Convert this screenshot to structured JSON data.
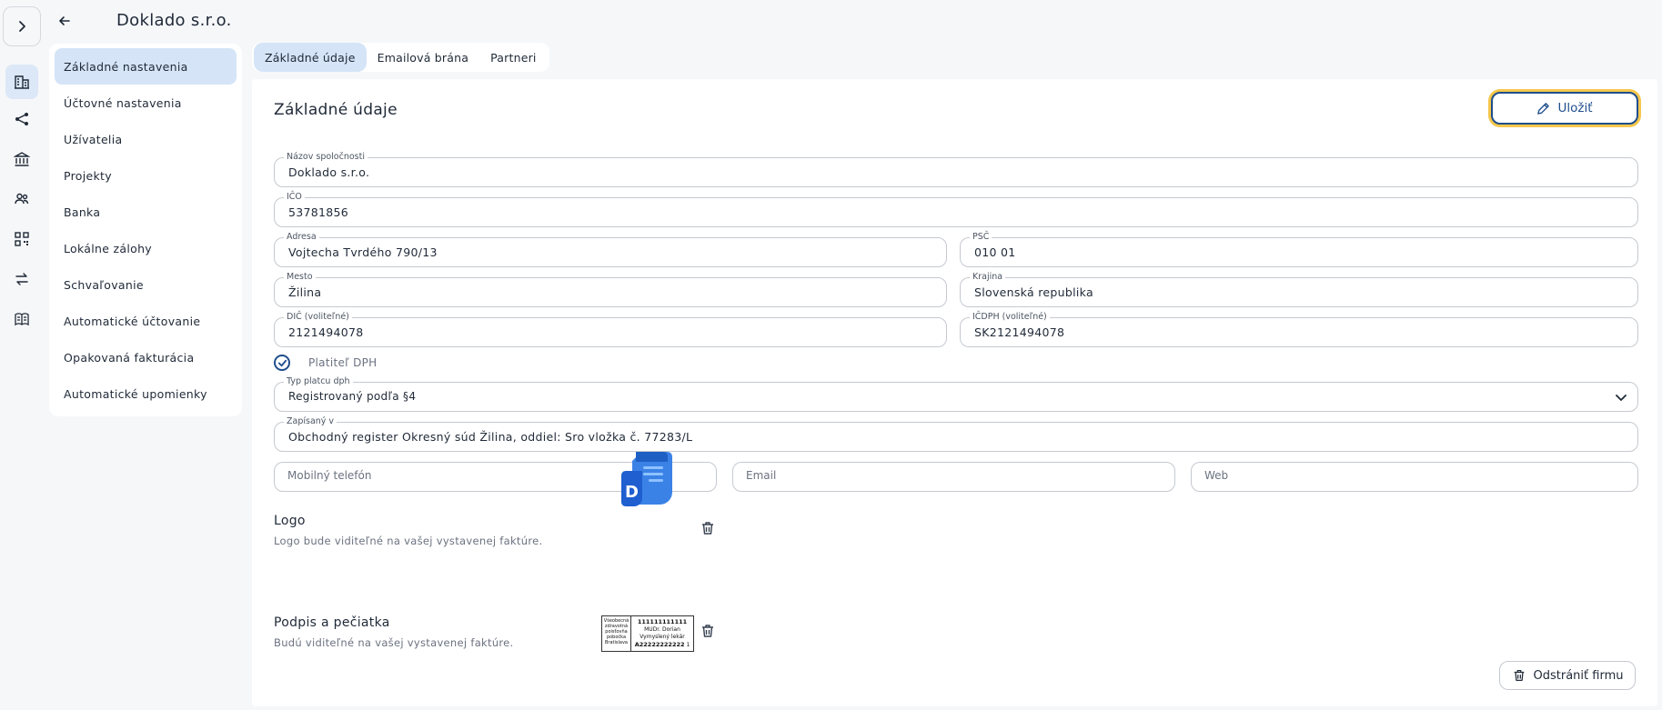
{
  "header": {
    "title": "Doklado s.r.o."
  },
  "menu": {
    "items": [
      {
        "label": "Základné nastavenia",
        "active": true
      },
      {
        "label": "Účtovné nastavenia"
      },
      {
        "label": "Užívatelia"
      },
      {
        "label": "Projekty"
      },
      {
        "label": "Banka"
      },
      {
        "label": "Lokálne zálohy"
      },
      {
        "label": "Schvaľovanie"
      },
      {
        "label": "Automatické účtovanie"
      },
      {
        "label": "Opakovaná fakturácia"
      },
      {
        "label": "Automatické upomienky"
      }
    ]
  },
  "tabs": [
    {
      "label": "Základné údaje",
      "active": true
    },
    {
      "label": "Emailová brána"
    },
    {
      "label": "Partneri"
    }
  ],
  "section": {
    "title": "Základné údaje",
    "save_label": "Uložiť"
  },
  "fields": {
    "company_name": {
      "label": "Názov spoločnosti",
      "value": "Doklado s.r.o."
    },
    "ico": {
      "label": "IČO",
      "value": "53781856"
    },
    "address": {
      "label": "Adresa",
      "value": "Vojtecha Tvrdého 790/13"
    },
    "psc": {
      "label": "PSČ",
      "value": "010 01"
    },
    "city": {
      "label": "Mesto",
      "value": "Žilina"
    },
    "country": {
      "label": "Krajina",
      "value": "Slovenská republika"
    },
    "dic": {
      "label": "DIČ (voliteľné)",
      "value": "2121494078"
    },
    "icdph": {
      "label": "IČDPH (voliteľné)",
      "value": "SK2121494078"
    },
    "vat_payer": {
      "label": "Platiteľ DPH",
      "checked": true
    },
    "vat_type": {
      "label": "Typ platcu dph",
      "value": "Registrovaný podľa §4"
    },
    "registered": {
      "label": "Zapísaný v",
      "value": "Obchodný register Okresný súd Žilina, oddiel: Sro vložka č. 77283/L"
    },
    "phone": {
      "placeholder": "Mobilný telefón"
    },
    "email": {
      "placeholder": "Email"
    },
    "web": {
      "placeholder": "Web"
    }
  },
  "logo": {
    "title": "Logo",
    "description": "Logo bude viditeľné na vašej vystavenej faktúre.",
    "letter": "D"
  },
  "signature": {
    "title": "Podpis a pečiatka",
    "description": "Budú viditeľné na vašej vystavenej faktúre.",
    "stamp_left": "Všeobecná zdravotná poisťovňa pobočka Bratislava",
    "stamp_line1": "111111111111",
    "stamp_line2": "MUDr. Dorian Vymyslený lekár",
    "stamp_line3": "A22222222222",
    "stamp_mark": "1"
  },
  "delete_label": "Odstrániť firmu",
  "colors": {
    "primary": "#1f4e8c",
    "active_bg": "#d5e4f7",
    "focus_ring": "#f5c74d"
  }
}
